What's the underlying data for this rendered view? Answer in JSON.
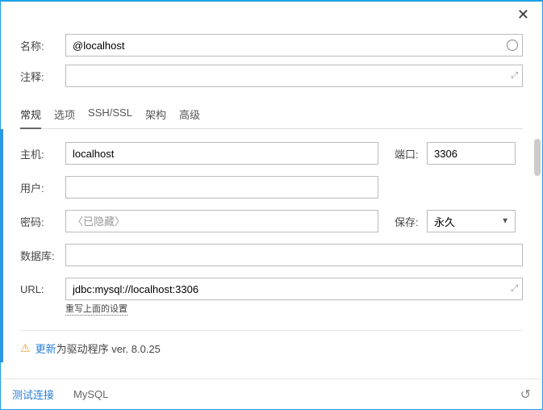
{
  "titlebar": {
    "close": "✕"
  },
  "top": {
    "name_label": "名称:",
    "name_value": "@localhost",
    "comment_label": "注释:",
    "comment_value": ""
  },
  "tabs": {
    "general": "常规",
    "options": "选项",
    "sshssl": "SSH/SSL",
    "schemas": "架构",
    "advanced": "高级"
  },
  "main": {
    "host_label": "主机:",
    "host_value": "localhost",
    "port_label": "端口:",
    "port_value": "3306",
    "user_label": "用户:",
    "user_value": "",
    "password_label": "密码:",
    "password_placeholder": "〈已隐藏〉",
    "save_label": "保存:",
    "save_value": "永久",
    "database_label": "数据库:",
    "database_value": "",
    "url_label": "URL:",
    "url_value": "jdbc:mysql://localhost:3306",
    "url_hint": "重写上面的设置"
  },
  "driver": {
    "update_link": "更新",
    "text": "为驱动程序 ver. 8.0.25"
  },
  "footer": {
    "test_connection": "测试连接",
    "db_name": "MySQL"
  }
}
